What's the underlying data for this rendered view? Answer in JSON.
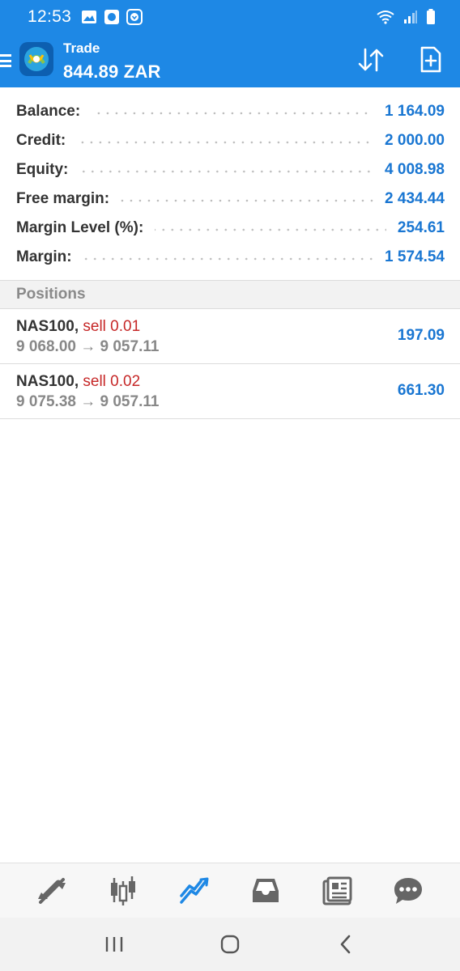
{
  "status_bar": {
    "time": "12:53",
    "icons_left": [
      "gallery-icon",
      "app-notification-icon",
      "download-icon"
    ],
    "icons_right": [
      "wifi-icon",
      "signal-icon",
      "battery-icon"
    ]
  },
  "app_bar": {
    "title": "Trade",
    "subtitle": "844.89 ZAR",
    "color": "#1e88e5"
  },
  "summary": {
    "rows": [
      {
        "label": "Balance:",
        "value": "1 164.09"
      },
      {
        "label": "Credit:",
        "value": "2 000.00"
      },
      {
        "label": "Equity:",
        "value": "4 008.98"
      },
      {
        "label": "Free margin:",
        "value": "2 434.44"
      },
      {
        "label": "Margin Level (%):",
        "value": "254.61"
      },
      {
        "label": "Margin:",
        "value": "1 574.54"
      }
    ]
  },
  "positions": {
    "header": "Positions",
    "items": [
      {
        "symbol": "NAS100",
        "sep": ", ",
        "side": "sell 0.01",
        "prices": "9 068.00 → 9 057.11",
        "profit": "197.09"
      },
      {
        "symbol": "NAS100",
        "sep": ", ",
        "side": "sell 0.02",
        "prices": "9 075.38 → 9 057.11",
        "profit": "661.30"
      }
    ]
  },
  "bottom_nav": {
    "items": [
      "quotes-icon",
      "chart-icon",
      "trade-icon",
      "history-icon",
      "news-icon",
      "chat-icon"
    ],
    "active": "trade-icon",
    "active_color": "#1e88e5"
  },
  "system_nav": [
    "recent-apps-icon",
    "home-icon",
    "back-icon"
  ]
}
